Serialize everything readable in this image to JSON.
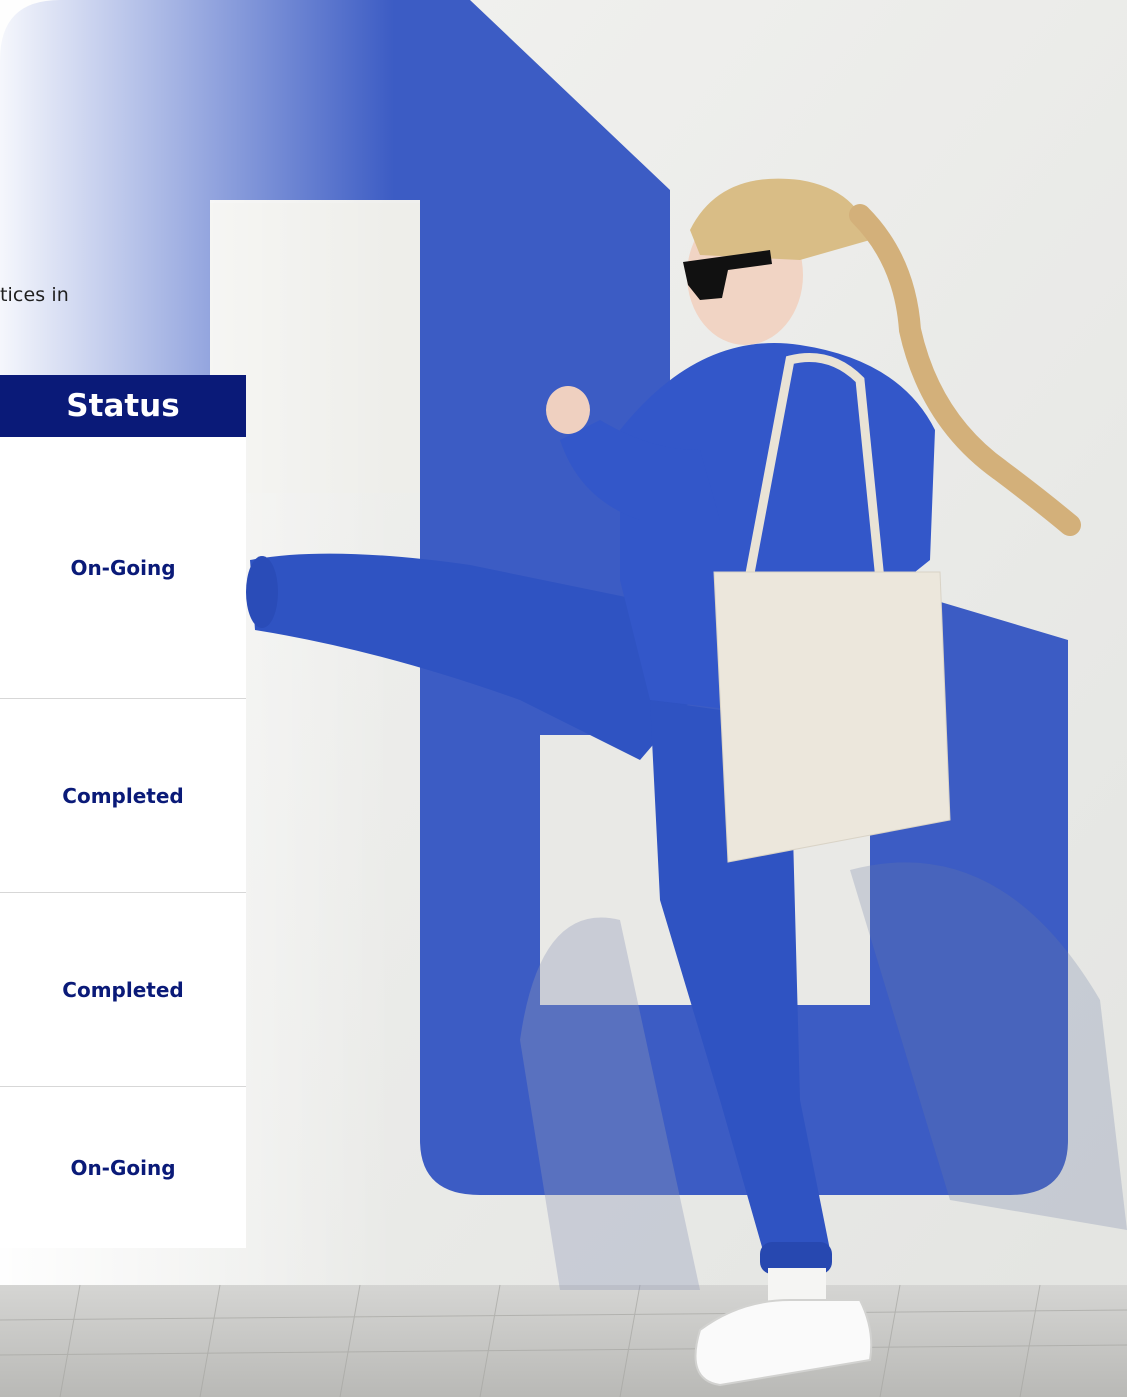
{
  "intro": {
    "text_fragment": "tices in"
  },
  "status_table": {
    "header": "Status",
    "rows": [
      {
        "status": "On-Going"
      },
      {
        "status": "Completed"
      },
      {
        "status": "Completed"
      },
      {
        "status": "On-Going"
      }
    ]
  },
  "colors": {
    "header_bg": "#0a1a78",
    "status_text": "#0a1a78",
    "mural_blue": "#3c5cc4",
    "wall": "#eeefec"
  },
  "background": {
    "icon": "hero-photo-woman-kicking-blue-mural"
  }
}
